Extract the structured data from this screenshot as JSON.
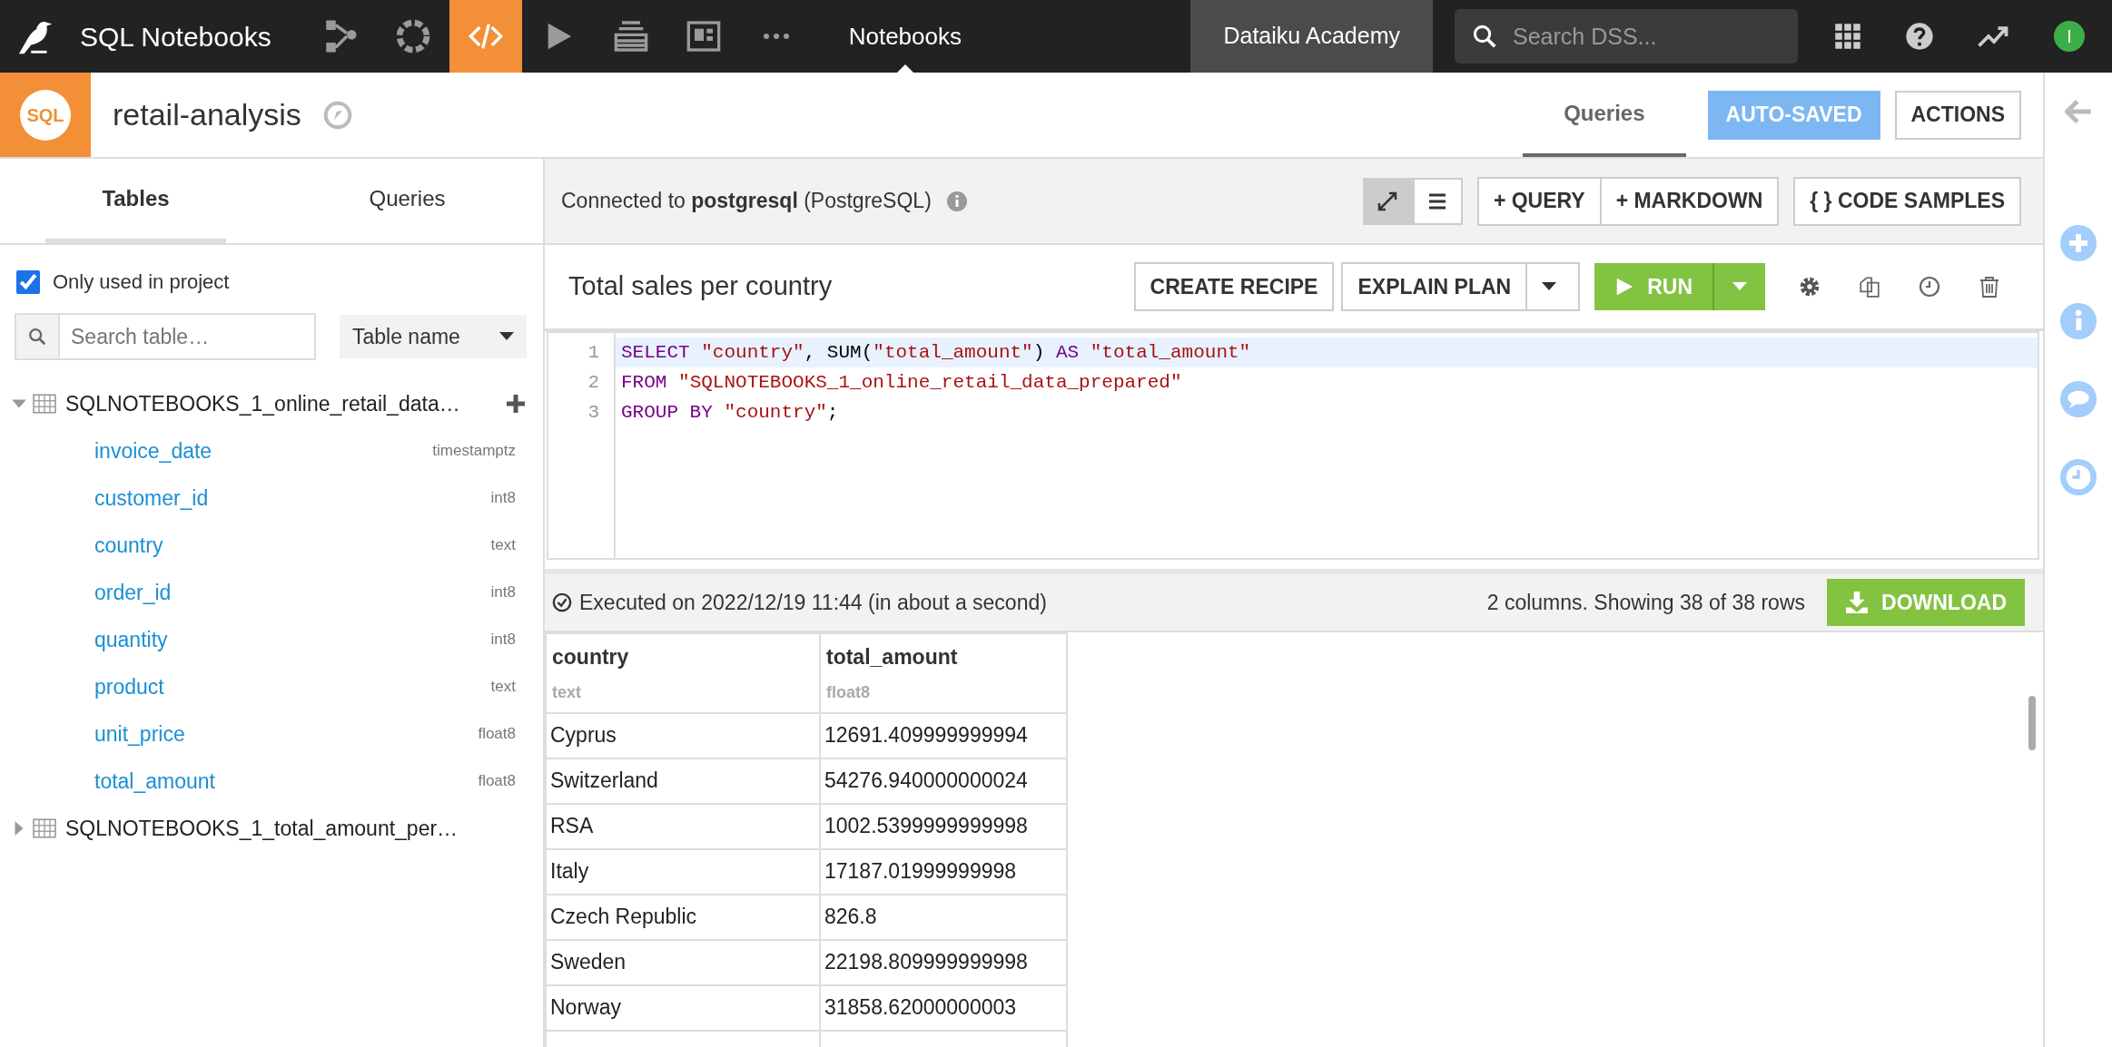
{
  "topbar": {
    "app_title": "SQL Notebooks",
    "nav_icons": [
      {
        "kind": "flow",
        "selected": false
      },
      {
        "kind": "ring",
        "selected": false
      },
      {
        "kind": "code",
        "selected": true
      },
      {
        "kind": "play",
        "selected": false
      },
      {
        "kind": "stack",
        "selected": false
      },
      {
        "kind": "dashboard",
        "selected": false
      },
      {
        "kind": "more",
        "selected": false
      }
    ],
    "section": "Notebooks",
    "workspace": "Dataiku Academy",
    "search": {
      "placeholder": "Search DSS..."
    },
    "avatar_initial": "I"
  },
  "header": {
    "badge": "SQL",
    "title": "retail-analysis",
    "tabs": [
      {
        "label": "Queries",
        "selected": true
      }
    ],
    "status_button": "AUTO-SAVED",
    "actions_button": "ACTIONS"
  },
  "sidebar": {
    "tabs": [
      {
        "label": "Tables",
        "selected": true
      },
      {
        "label": "Queries",
        "selected": false
      }
    ],
    "filter": {
      "label": "Only used in project",
      "checked": true
    },
    "search": {
      "placeholder": "Search table…"
    },
    "sort": "Table name",
    "tables": [
      {
        "name": "SQLNOTEBOOKS_1_online_retail_data…",
        "expanded": true,
        "children": [
          {
            "name": "invoice_date",
            "type": "timestamptz"
          },
          {
            "name": "customer_id",
            "type": "int8"
          },
          {
            "name": "country",
            "type": "text"
          },
          {
            "name": "order_id",
            "type": "int8"
          },
          {
            "name": "quantity",
            "type": "int8"
          },
          {
            "name": "product",
            "type": "text"
          },
          {
            "name": "unit_price",
            "type": "float8"
          },
          {
            "name": "total_amount",
            "type": "float8"
          }
        ]
      },
      {
        "name": "SQLNOTEBOOKS_1_total_amount_per…",
        "expanded": false
      }
    ]
  },
  "connection": {
    "text": "Connected to **postgresql** (PostgreSQL)",
    "buttons": [
      "+ QUERY",
      "+ MARKDOWN"
    ],
    "code_samples": "{ } CODE SAMPLES",
    "views": [
      {
        "kind": "expand",
        "selected": true
      },
      {
        "kind": "list",
        "selected": false
      }
    ]
  },
  "query": {
    "title": "Total sales per country",
    "create_recipe": "CREATE RECIPE",
    "explain_plan": "EXPLAIN PLAN",
    "run": "RUN",
    "lines": [
      {
        "number": "1",
        "active": true,
        "tokens": [
          {
            "kind": "keyword",
            "text": "SELECT"
          },
          {
            "kind": "string",
            "text": " \"country\""
          },
          {
            "kind": "plain",
            "text": ", SUM("
          },
          {
            "kind": "string",
            "text": "\"total_amount\""
          },
          {
            "kind": "plain",
            "text": ") "
          },
          {
            "kind": "keyword",
            "text": "AS"
          },
          {
            "kind": "string",
            "text": " \"total_amount\""
          }
        ]
      },
      {
        "number": "2",
        "active": false,
        "tokens": [
          {
            "kind": "keyword",
            "text": "FROM"
          },
          {
            "kind": "string",
            "text": " \"SQLNOTEBOOKS_1_online_retail_data_prepared\""
          }
        ]
      },
      {
        "number": "3",
        "active": false,
        "tokens": [
          {
            "kind": "keyword",
            "text": "GROUP BY"
          },
          {
            "kind": "string",
            "text": " \"country\""
          },
          {
            "kind": "plain",
            "text": ";"
          }
        ]
      }
    ]
  },
  "result": {
    "status": "Executed on 2022/12/19 11:44 (in about a second)",
    "summary": "2 columns. Showing 38 of 38 rows",
    "download": "DOWNLOAD",
    "columns": [
      {
        "name": "country",
        "type": "text"
      },
      {
        "name": "total_amount",
        "type": "float8"
      }
    ],
    "rows": [
      [
        "Cyprus",
        "12691.409999999994"
      ],
      [
        "Switzerland",
        "54276.940000000024"
      ],
      [
        "RSA",
        "1002.5399999999998"
      ],
      [
        "Italy",
        "17187.01999999998"
      ],
      [
        "Czech Republic",
        "826.8"
      ],
      [
        "Sweden",
        "22198.809999999998"
      ],
      [
        "Norway",
        "31858.62000000003"
      ]
    ]
  }
}
